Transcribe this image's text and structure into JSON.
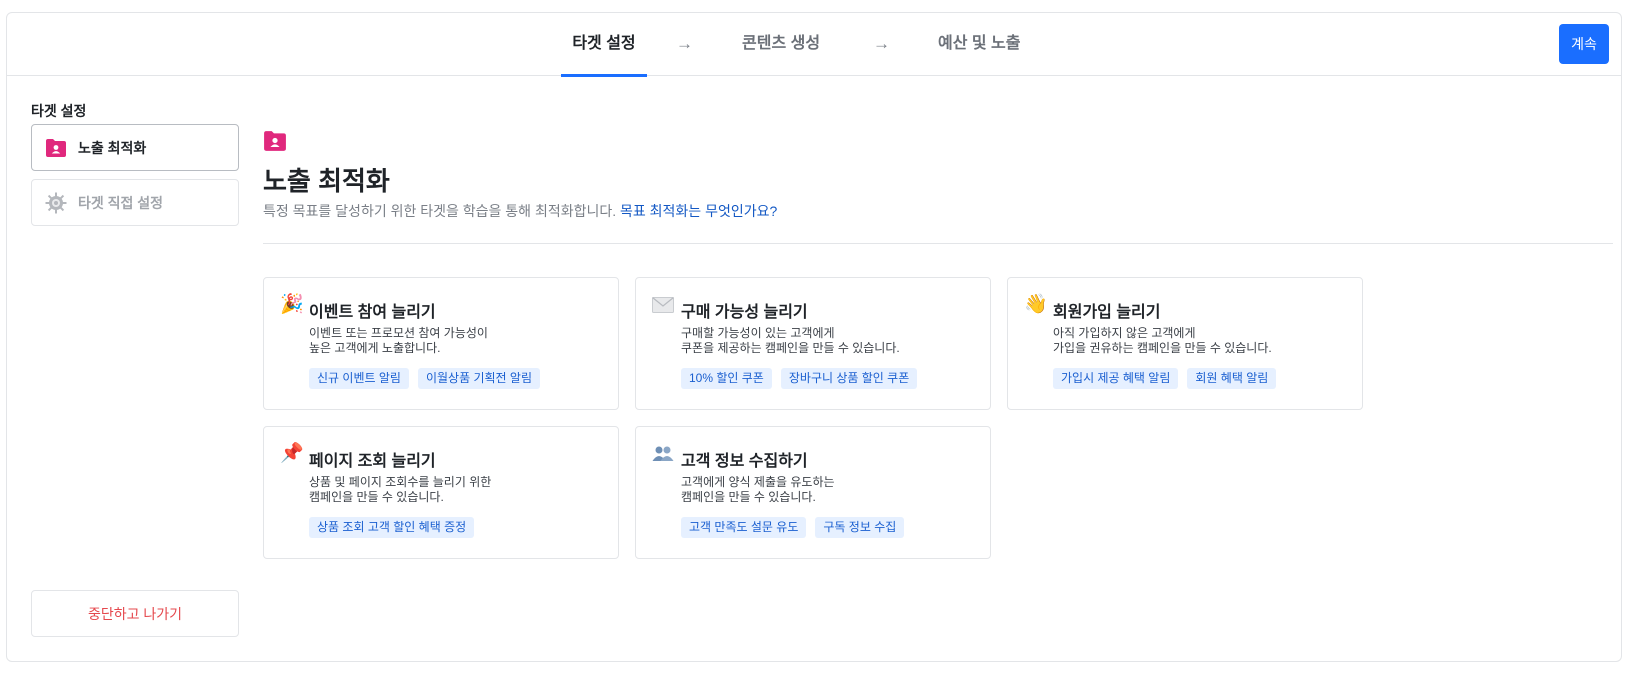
{
  "header": {
    "steps": [
      {
        "label": "타겟 설정",
        "active": true
      },
      {
        "label": "콘텐츠 생성",
        "active": false
      },
      {
        "label": "예산 및 노출",
        "active": false
      }
    ],
    "arrow": "→",
    "continue_label": "계속"
  },
  "colors": {
    "accent": "#1a6eff",
    "brand_pink": "#e0287d",
    "tag_bg": "#e6f0ff",
    "danger": "#e5484d"
  },
  "sidebar": {
    "title": "타겟 설정",
    "items": [
      {
        "label": "노출 최적화",
        "icon": "folder-user-icon",
        "selected": true
      },
      {
        "label": "타겟 직접 설정",
        "icon": "gear-icon",
        "selected": false
      }
    ],
    "exit_label": "중단하고 나가기"
  },
  "main": {
    "icon": "folder-user-icon",
    "title": "노출 최적화",
    "description": "특정 목표를 달성하기 위한 타겟을 학습을 통해 최적화합니다.",
    "help_link": "목표 최적화는 무엇인가요?",
    "cards": [
      {
        "icon": "party-popper-icon",
        "title": "이벤트 참여 늘리기",
        "desc_line1": "이벤트 또는 프로모션 참여 가능성이",
        "desc_line2": "높은 고객에게 노출합니다.",
        "tags": [
          "신규 이벤트 알림",
          "이월상품 기획전 알림"
        ]
      },
      {
        "icon": "envelope-icon",
        "title": "구매 가능성 늘리기",
        "desc_line1": "구매할 가능성이 있는 고객에게",
        "desc_line2": "쿠폰을 제공하는 캠페인을 만들 수 있습니다.",
        "tags": [
          "10% 할인 쿠폰",
          "장바구니 상품 할인 쿠폰"
        ]
      },
      {
        "icon": "waving-hand-icon",
        "title": "회원가입 늘리기",
        "desc_line1": "아직 가입하지 않은 고객에게",
        "desc_line2": "가입을 권유하는 캠페인을 만들 수 있습니다.",
        "tags": [
          "가입시 제공 혜택 알림",
          "회원 혜택 알림"
        ]
      },
      {
        "icon": "pushpin-icon",
        "title": "페이지 조회 늘리기",
        "desc_line1": "상품 및 페이지 조회수를 늘리기 위한",
        "desc_line2": "캠페인을 만들 수 있습니다.",
        "tags": [
          "상품 조회 고객 할인 혜택 증정"
        ]
      },
      {
        "icon": "users-icon",
        "title": "고객 정보 수집하기",
        "desc_line1": "고객에게 양식 제출을 유도하는",
        "desc_line2": "캠페인을 만들 수 있습니다.",
        "tags": [
          "고객 만족도 설문 유도",
          "구독 정보 수집"
        ]
      }
    ]
  }
}
